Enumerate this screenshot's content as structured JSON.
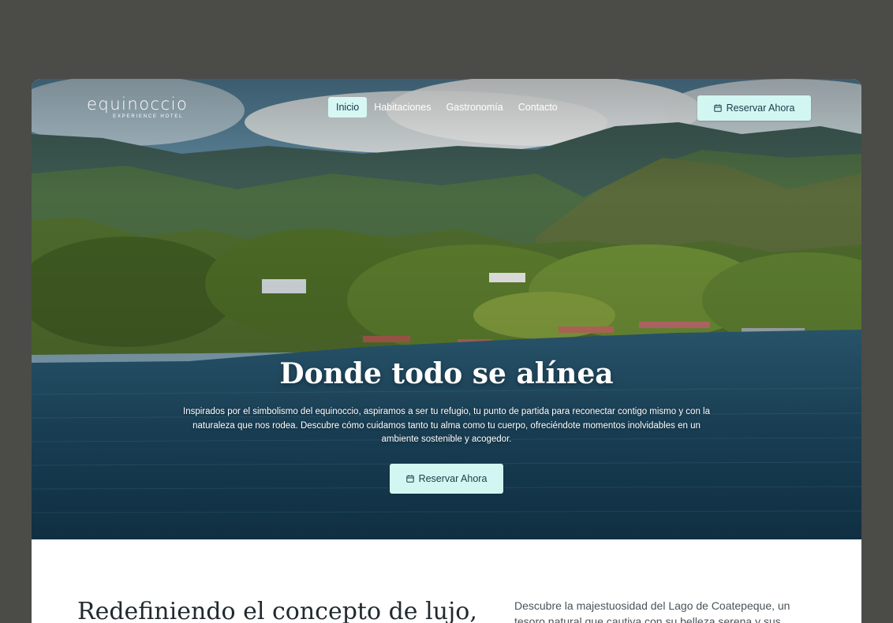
{
  "brand": {
    "logo_text": "equinoccio",
    "tagline": "EXPERIENCE HOTEL"
  },
  "nav": {
    "items": [
      {
        "label": "Inicio",
        "active": true
      },
      {
        "label": "Habitaciones",
        "active": false
      },
      {
        "label": "Gastronomía",
        "active": false
      },
      {
        "label": "Contacto",
        "active": false
      }
    ],
    "cta_label": "Reservar Ahora"
  },
  "hero": {
    "title": "Donde todo se alínea",
    "description": "Inspirados por el simbolismo del equinoccio, aspiramos a ser tu refugio, tu punto de partida para reconectar contigo mismo y con la naturaleza que nos rodea. Descubre cómo cuidamos tanto tu alma como tu cuerpo, ofreciéndote momentos inolvidables en un ambiente sostenible y acogedor.",
    "cta_label": "Reservar Ahora"
  },
  "intro": {
    "heading": "Redefiniendo el concepto de lujo,",
    "text": "Descubre la majestuosidad del Lago de Coatepeque, un tesoro natural que cautiva con su belleza serena y sus"
  },
  "icons": {
    "calendar": "calendar-icon"
  },
  "colors": {
    "page_background": "#4b4b48",
    "accent": "#d2f6f1",
    "accent_text": "#1b3b4a",
    "lake": "#1f4a63",
    "forest": "#4e6a2c"
  }
}
